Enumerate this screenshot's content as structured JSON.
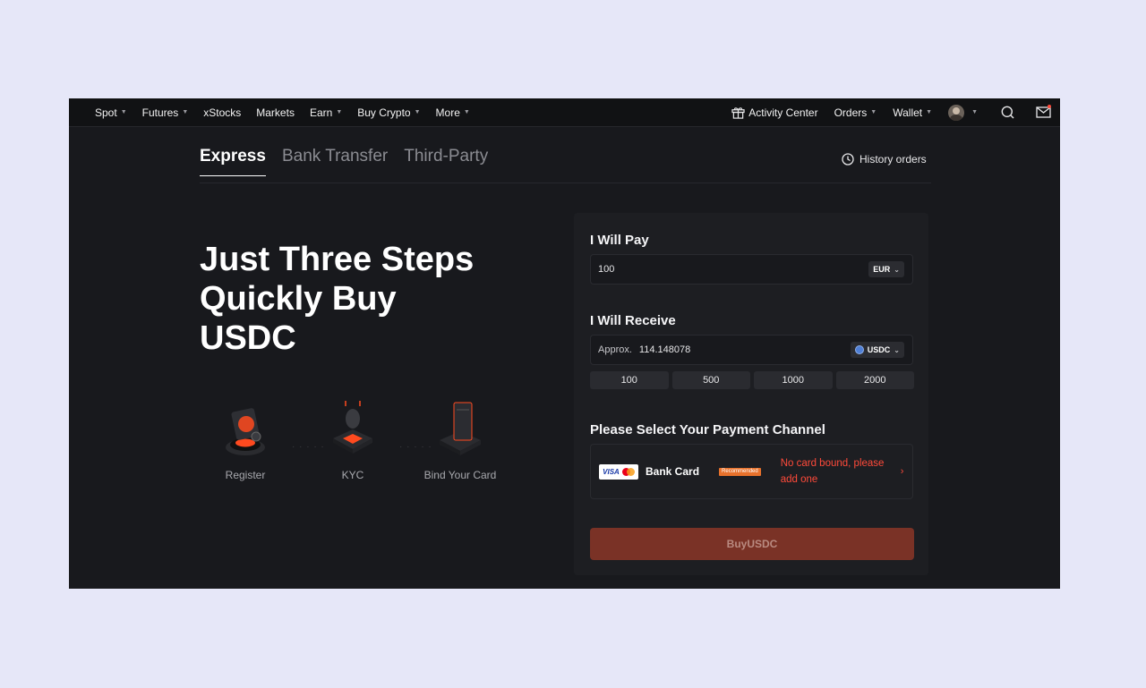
{
  "nav": {
    "left": [
      {
        "label": "Spot",
        "dropdown": true
      },
      {
        "label": "Futures",
        "dropdown": true
      },
      {
        "label": "xStocks",
        "dropdown": false
      },
      {
        "label": "Markets",
        "dropdown": false
      },
      {
        "label": "Earn",
        "dropdown": true
      },
      {
        "label": "Buy Crypto",
        "dropdown": true
      },
      {
        "label": "More",
        "dropdown": true
      }
    ],
    "activity_center": "Activity Center",
    "orders": "Orders",
    "wallet": "Wallet",
    "icons": [
      "gift-icon",
      "avatar",
      "search-icon",
      "mail-icon"
    ]
  },
  "tabs": [
    "Express",
    "Bank Transfer",
    "Third-Party"
  ],
  "active_tab": "Express",
  "history_orders": "History orders",
  "hero": {
    "line1": "Just Three Steps",
    "line2": "Quickly Buy",
    "line3": "USDC"
  },
  "steps": [
    "Register",
    "KYC",
    "Bind Your Card"
  ],
  "pay": {
    "title": "I Will Pay",
    "amount": "100",
    "currency": "EUR"
  },
  "receive": {
    "title": "I Will Receive",
    "approx_label": "Approx.",
    "amount": "114.148078",
    "currency": "USDC"
  },
  "quick_amounts": [
    "100",
    "500",
    "1000",
    "2000"
  ],
  "payment": {
    "title": "Please Select Your Payment Channel",
    "brand_visa": "VISA",
    "method": "Bank Card",
    "badge": "Recommended",
    "warning": "No card bound, please add one"
  },
  "buy_button": "BuyUSDC",
  "colors": {
    "page_bg": "#e6e7f8",
    "app_bg": "#18191d",
    "accent": "#ff4a3a",
    "buy_button": "#7a3226"
  }
}
